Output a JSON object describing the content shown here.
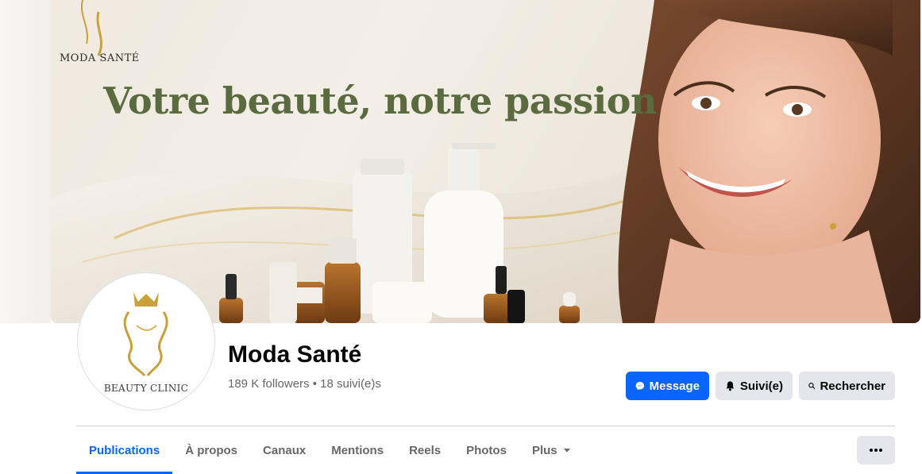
{
  "cover": {
    "brand": "MODA SANTÉ",
    "tagline": "Votre beauté, notre passion"
  },
  "avatar": {
    "text": "BEAUTY CLINIC"
  },
  "page": {
    "title": "Moda Santé",
    "stats": "189 K followers • 18 suivi(e)s"
  },
  "actions": {
    "message": "Message",
    "follow": "Suivi(e)",
    "search": "Rechercher"
  },
  "tabs": [
    "Publications",
    "À propos",
    "Canaux",
    "Mentions",
    "Reels",
    "Photos",
    "Plus"
  ],
  "icons": {
    "message": "messenger-icon",
    "follow": "bell-icon",
    "search": "search-icon",
    "more": "more-dots-icon",
    "plus_caret": "caret-down-icon"
  },
  "colors": {
    "accent": "#0866ff",
    "tagline": "#5a6b3f",
    "gold": "#c9a03a"
  }
}
